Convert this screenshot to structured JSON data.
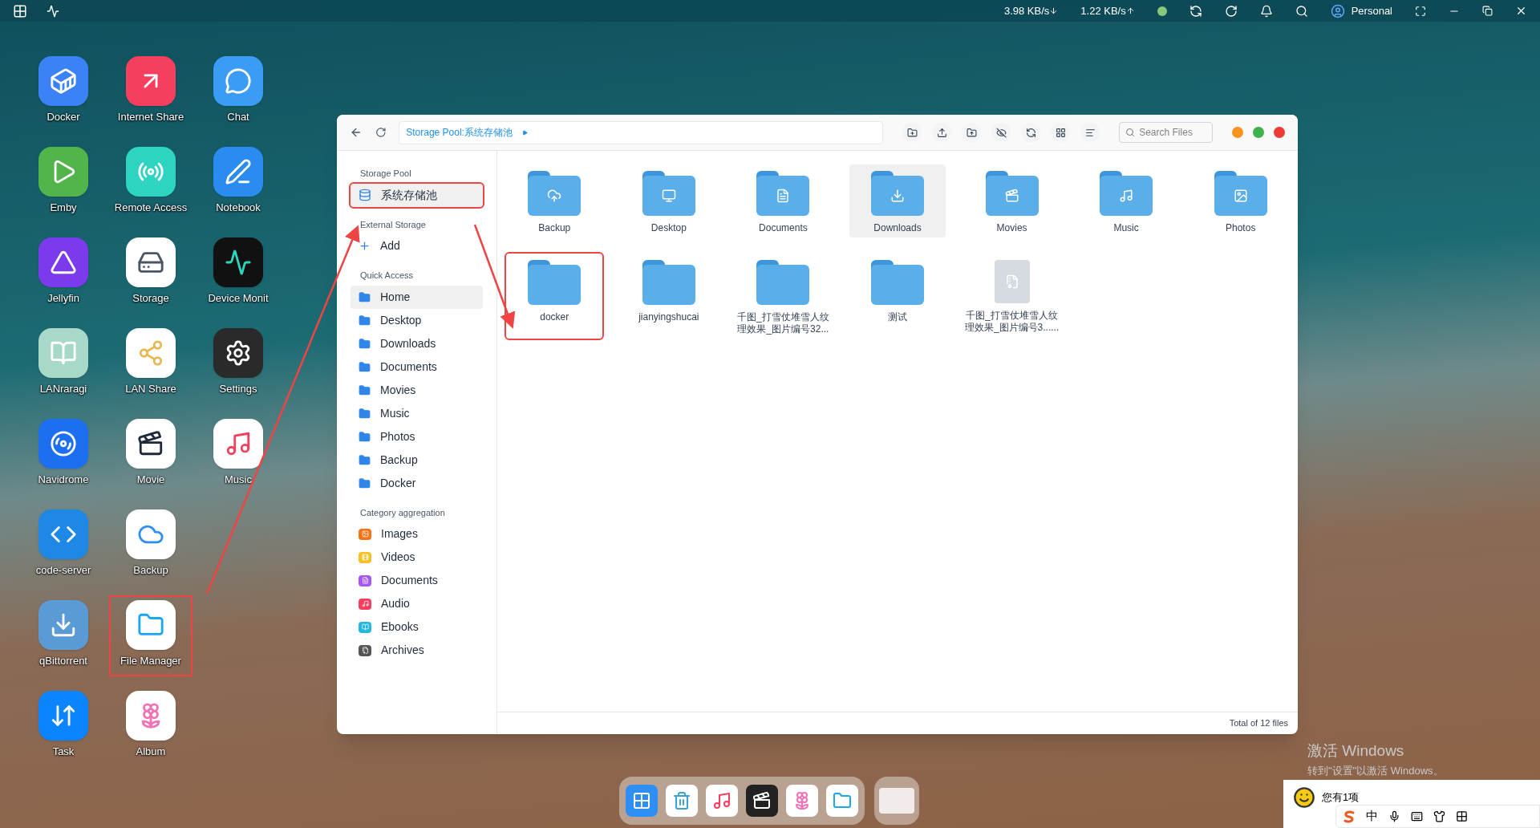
{
  "top_bar": {
    "download": "3.98 KB/s",
    "upload": "1.22 KB/s",
    "user": "Personal"
  },
  "desktop_apps": [
    {
      "label": "Docker",
      "highlighted": false
    },
    {
      "label": "Emby",
      "highlighted": false
    },
    {
      "label": "Jellyfin",
      "highlighted": false
    },
    {
      "label": "LANraragi",
      "highlighted": false
    },
    {
      "label": "Navidrome",
      "highlighted": false
    },
    {
      "label": "code-server",
      "highlighted": false
    },
    {
      "label": "qBittorrent",
      "highlighted": false
    },
    {
      "label": "Task",
      "highlighted": false
    },
    {
      "label": "Internet Share",
      "highlighted": false
    },
    {
      "label": "Remote Access",
      "highlighted": false
    },
    {
      "label": "Storage",
      "highlighted": false
    },
    {
      "label": "LAN Share",
      "highlighted": false
    },
    {
      "label": "Movie",
      "highlighted": false
    },
    {
      "label": "Backup",
      "highlighted": false
    },
    {
      "label": "File Manager",
      "highlighted": true
    },
    {
      "label": "Album",
      "highlighted": false
    },
    {
      "label": "Chat",
      "highlighted": false
    },
    {
      "label": "Notebook",
      "highlighted": false
    },
    {
      "label": "Device Monit",
      "highlighted": false
    },
    {
      "label": "Settings",
      "highlighted": false
    },
    {
      "label": "Music",
      "highlighted": false
    }
  ],
  "window": {
    "path": "Storage Pool:系统存储池",
    "search": {
      "placeholder": "Search Files"
    },
    "sidebar": [
      {
        "title": "Storage Pool",
        "kind": "pool",
        "items": [
          {
            "label": "系统存储池",
            "selected": true,
            "highlighted": true
          }
        ]
      },
      {
        "title": "External Storage",
        "kind": "add",
        "items": [
          {
            "label": "Add",
            "selected": false,
            "highlighted": false
          }
        ]
      },
      {
        "title": "Quick Access",
        "kind": "folder",
        "items": [
          {
            "label": "Home",
            "selected": true,
            "highlighted": false
          },
          {
            "label": "Desktop",
            "selected": false,
            "highlighted": false
          },
          {
            "label": "Downloads",
            "selected": false,
            "highlighted": false
          },
          {
            "label": "Documents",
            "selected": false,
            "highlighted": false
          },
          {
            "label": "Movies",
            "selected": false,
            "highlighted": false
          },
          {
            "label": "Music",
            "selected": false,
            "highlighted": false
          },
          {
            "label": "Photos",
            "selected": false,
            "highlighted": false
          },
          {
            "label": "Backup",
            "selected": false,
            "highlighted": false
          },
          {
            "label": "Docker",
            "selected": false,
            "highlighted": false
          }
        ]
      },
      {
        "title": "Category aggregation",
        "kind": "category",
        "items": [
          {
            "label": "Images",
            "selected": false,
            "highlighted": false,
            "color": "#f97316"
          },
          {
            "label": "Videos",
            "selected": false,
            "highlighted": false,
            "color": "#fbbf24"
          },
          {
            "label": "Documents",
            "selected": false,
            "highlighted": false,
            "color": "#a855f7"
          },
          {
            "label": "Audio",
            "selected": false,
            "highlighted": false,
            "color": "#f43f5e"
          },
          {
            "label": "Ebooks",
            "selected": false,
            "highlighted": false,
            "color": "#22b8e0"
          },
          {
            "label": "Archives",
            "selected": false,
            "highlighted": false,
            "color": "#555555"
          }
        ]
      }
    ],
    "files": [
      {
        "name": "Backup",
        "kind": "folder",
        "selected": false,
        "highlighted": false
      },
      {
        "name": "Desktop",
        "kind": "folder",
        "selected": false,
        "highlighted": false
      },
      {
        "name": "Documents",
        "kind": "folder",
        "selected": false,
        "highlighted": false
      },
      {
        "name": "Downloads",
        "kind": "folder",
        "selected": true,
        "highlighted": false
      },
      {
        "name": "Movies",
        "kind": "folder",
        "selected": false,
        "highlighted": false
      },
      {
        "name": "Music",
        "kind": "folder",
        "selected": false,
        "highlighted": false
      },
      {
        "name": "Photos",
        "kind": "folder",
        "selected": false,
        "highlighted": false
      },
      {
        "name": "docker",
        "kind": "folder",
        "selected": false,
        "highlighted": true
      },
      {
        "name": "jianyingshucai",
        "kind": "folder",
        "selected": false,
        "highlighted": false
      },
      {
        "name": "千图_打雪仗堆雪人纹理效果_图片编号32...",
        "kind": "folder",
        "selected": false,
        "highlighted": false
      },
      {
        "name": "测试",
        "kind": "folder",
        "selected": false,
        "highlighted": false
      },
      {
        "name": "千图_打雪仗堆雪人纹理效果_图片编号3......",
        "kind": "file",
        "selected": false,
        "highlighted": false
      }
    ],
    "status": "Total of 12 files"
  },
  "activation_notice": {
    "title": "激活 Windows",
    "hint": "转到\"设置\"以激活 Windows。"
  },
  "ime": {
    "message": "您有1项",
    "mode": "中"
  }
}
